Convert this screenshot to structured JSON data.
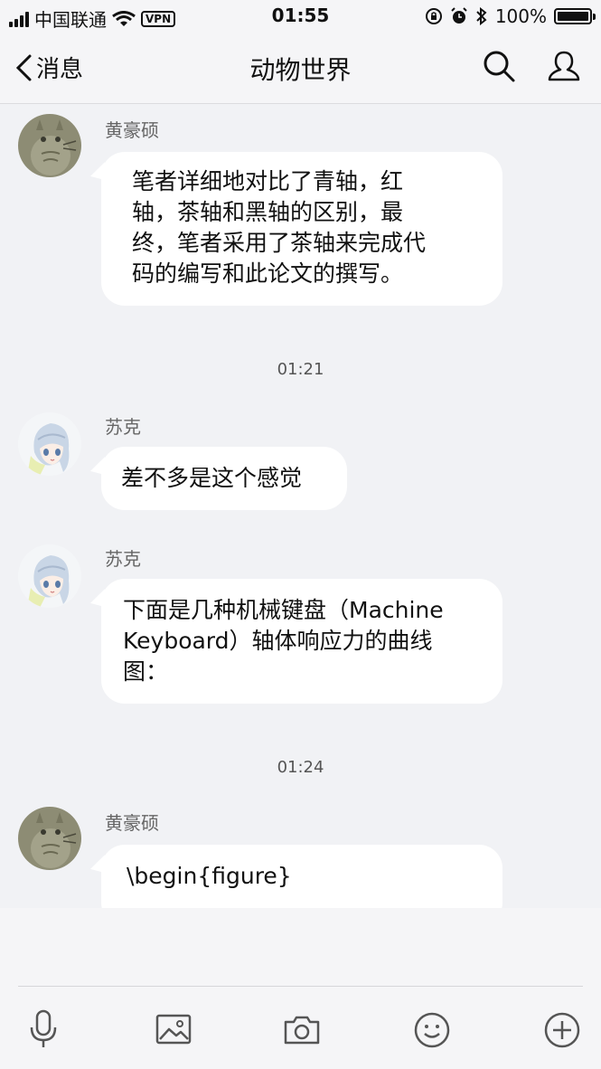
{
  "status_bar": {
    "carrier": "中国联通",
    "vpn": "VPN",
    "time": "01:55",
    "battery": "100%",
    "battery_level": 1.0
  },
  "nav": {
    "back_label": "消息",
    "title": "动物世界",
    "icons": [
      "search-icon",
      "contact-icon"
    ]
  },
  "messages": [
    {
      "sender": "黄豪硕",
      "lines": [
        "笔者详细地对比了青轴，红",
        "轴，茶轴和黑轴的区别，最",
        "终，笔者采用了茶轴来完成代",
        "码的编写和此论文的撰写。"
      ]
    },
    {
      "timestamp": "01:21"
    },
    {
      "sender": "苏克",
      "lines": [
        "差不多是这个感觉"
      ]
    },
    {
      "sender": "苏克",
      "lines": [
        "下面是几种机械键盘（Machine",
        " Keyboard）轴体响应力的曲线",
        "图："
      ]
    },
    {
      "timestamp": "01:24"
    },
    {
      "sender": "黄豪硕",
      "lines": [
        "\\begin{figure}"
      ]
    }
  ],
  "toolbar": [
    "microphone-icon",
    "image-icon",
    "camera-icon",
    "emoji-icon",
    "plus-icon"
  ],
  "colors": {
    "background": "#f1f2f5",
    "bubble": "#ffffff",
    "bar": "#f5f5f7"
  }
}
